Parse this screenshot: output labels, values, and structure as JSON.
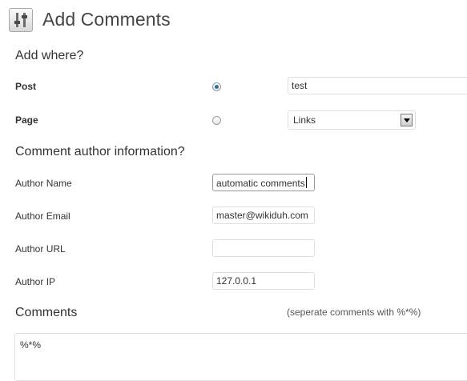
{
  "header": {
    "title": "Add Comments",
    "icon": "sliders-icon"
  },
  "where": {
    "title": "Add where?",
    "post": {
      "label": "Post",
      "selected": true,
      "value": "test"
    },
    "page": {
      "label": "Page",
      "selected": false,
      "value": "Links"
    }
  },
  "author": {
    "title": "Comment author information?",
    "name": {
      "label": "Author Name",
      "value": "automatic comments"
    },
    "email": {
      "label": "Author Email",
      "value": "master@wikiduh.com"
    },
    "url": {
      "label": "Author URL",
      "value": ""
    },
    "ip": {
      "label": "Author IP",
      "value": "127.0.0.1"
    }
  },
  "comments": {
    "title": "Comments",
    "hint": "(seperate comments with %*%)",
    "value": "%*%"
  },
  "colors": {
    "accent": "#21759b",
    "border": "#dfdfdf"
  }
}
